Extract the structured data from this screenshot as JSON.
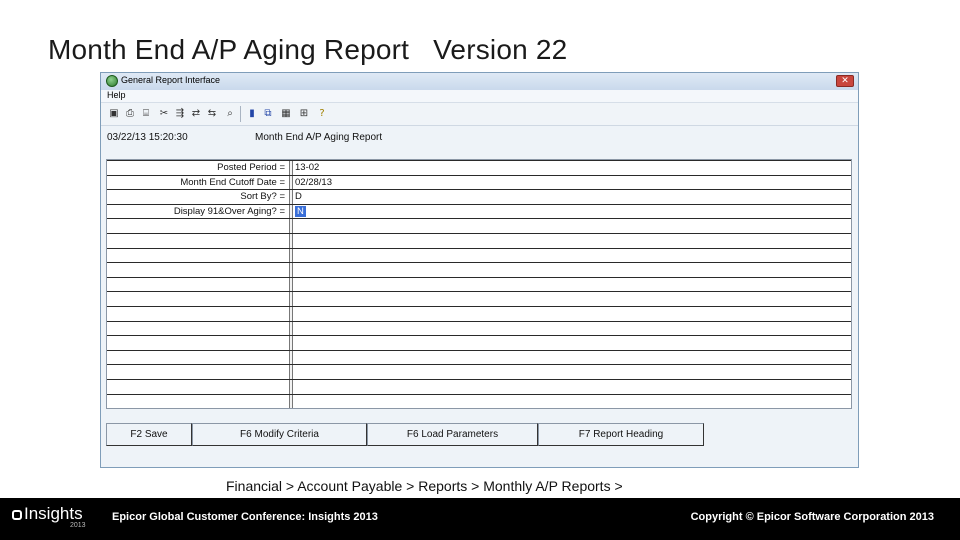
{
  "slide": {
    "title": "Month End A/P Aging Report   Version 22",
    "breadcrumb": "Financial > Account Payable > Reports > Monthly A/P Reports >"
  },
  "window": {
    "title": "General Report Interface",
    "close_label": "✕",
    "menu": [
      "Help"
    ]
  },
  "toolbar": {
    "icons": [
      "save-icon",
      "print-icon",
      "print-preview-icon",
      "scissors-icon",
      "run-icon",
      "arrows-icon",
      "move-icon",
      "search-icon",
      "book-icon",
      "copy-icon",
      "calculator-icon",
      "export-icon",
      "help-icon"
    ]
  },
  "report_header": {
    "datetime": "03/22/13 15:20:30",
    "title": "Month End A/P Aging Report"
  },
  "parameters": [
    {
      "label": "Posted Period =",
      "value": "13-02",
      "selected": false
    },
    {
      "label": "Month End Cutoff Date =",
      "value": "02/28/13",
      "selected": false
    },
    {
      "label": "Sort By? =",
      "value": "D",
      "selected": false
    },
    {
      "label": "Display 91&Over Aging? =",
      "value": "N",
      "selected": true
    }
  ],
  "empty_rows": 13,
  "function_keys": [
    {
      "label": "F2 Save"
    },
    {
      "label": "F6 Modify Criteria"
    },
    {
      "label": "F6 Load Parameters"
    },
    {
      "label": "F7 Report Heading"
    }
  ],
  "footer": {
    "logo_text": "Insights",
    "logo_year": "2013",
    "conference": "Epicor Global Customer Conference: Insights 2013",
    "copyright": "Copyright © Epicor Software Corporation 2013"
  },
  "colors": {
    "selection": "#3a6fd8",
    "footer_bg": "#000000",
    "window_bg": "#eef3f8"
  }
}
